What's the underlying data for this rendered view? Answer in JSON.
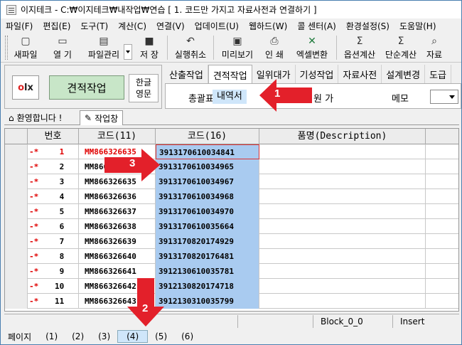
{
  "window": {
    "title": "이지테크 - C:₩이지테크₩내작업₩연습 [ 1. 코드만 가지고 자료사전과 연결하기 ]"
  },
  "menu": [
    "파일(F)",
    "편집(E)",
    "도구(T)",
    "계산(C)",
    "연결(V)",
    "업데이트(U)",
    "웹하드(W)",
    "콜 센터(A)",
    "환경설정(S)",
    "도움말(H)"
  ],
  "toolbar": [
    {
      "label": "새파일",
      "icon": "new-file-icon",
      "glyph": "▢"
    },
    {
      "label": "열 기",
      "icon": "open-folder-icon",
      "glyph": "▭"
    },
    {
      "label": "파일관리",
      "icon": "file-manage-icon",
      "glyph": "▤"
    },
    {
      "label": "저 장",
      "icon": "save-icon",
      "glyph": "■"
    },
    {
      "label": "실행취소",
      "icon": "undo-icon",
      "glyph": "↶"
    },
    {
      "label": "미리보기",
      "icon": "preview-icon",
      "glyph": "▣"
    },
    {
      "label": "인 쇄",
      "icon": "print-icon",
      "glyph": "⎙"
    },
    {
      "label": "엑셀변환",
      "icon": "excel-icon",
      "glyph": "✕"
    },
    {
      "label": "옵션계산",
      "icon": "sigma-icon",
      "glyph": "Σ"
    },
    {
      "label": "단순계산",
      "icon": "sigma-icon",
      "glyph": "Σ"
    },
    {
      "label": "자료",
      "icon": "search-icon",
      "glyph": "⌕"
    }
  ],
  "left_panel": {
    "logo_o": "o",
    "logo_rest": "lx",
    "main_button": "견적작업",
    "lang_line1": "한글",
    "lang_line2": "영문"
  },
  "tabs": [
    "산출작업",
    "견적작업",
    "일위대가",
    "기성작업",
    "자료사전",
    "설계변경",
    "도급"
  ],
  "subtabs": {
    "s1": "총괄표",
    "s2": "내역서",
    "s3": "원 가",
    "s4": "메모"
  },
  "doc_tabs": {
    "t1": "환영합니다 !",
    "t2": "작업창"
  },
  "grid": {
    "headers": {
      "no": "번호",
      "code11": "코드(11)",
      "code16": "코드(16)",
      "name": "품명(Description)"
    },
    "rows": [
      {
        "mark": "-*",
        "no": "1",
        "code11": "MM866326635",
        "code16": "3913170610034841"
      },
      {
        "mark": "-*",
        "no": "2",
        "code11": "MM866326636",
        "code16": "3913170610034965"
      },
      {
        "mark": "-*",
        "no": "3",
        "code11": "MM866326635",
        "code16": "3913170610034967"
      },
      {
        "mark": "-*",
        "no": "4",
        "code11": "MM866326636",
        "code16": "3913170610034968"
      },
      {
        "mark": "-*",
        "no": "5",
        "code11": "MM866326637",
        "code16": "3913170610034970"
      },
      {
        "mark": "-*",
        "no": "6",
        "code11": "MM866326638",
        "code16": "3913170610035664"
      },
      {
        "mark": "-*",
        "no": "7",
        "code11": "MM866326639",
        "code16": "3913170820174929"
      },
      {
        "mark": "-*",
        "no": "8",
        "code11": "MM866326640",
        "code16": "3913170820176481"
      },
      {
        "mark": "-*",
        "no": "9",
        "code11": "MM866326641",
        "code16": "3912130610035781"
      },
      {
        "mark": "-*",
        "no": "10",
        "code11": "MM866326642",
        "code16": "3912130820174718"
      },
      {
        "mark": "-*",
        "no": "11",
        "code11": "MM866326643",
        "code16": "3912130310035799"
      }
    ]
  },
  "status": {
    "block": "Block_0_0",
    "mode": "Insert"
  },
  "pages": {
    "label": "페이지",
    "items": [
      "(1)",
      "(2)",
      "(3)",
      "(4)",
      "(5)",
      "(6)"
    ],
    "current": "(4)"
  },
  "callouts": {
    "n1": "1",
    "n2": "2",
    "n3": "3"
  },
  "colors": {
    "callout": "#e3202a",
    "selection": "#a9cbf0",
    "button_green": "#c8e6c8"
  }
}
